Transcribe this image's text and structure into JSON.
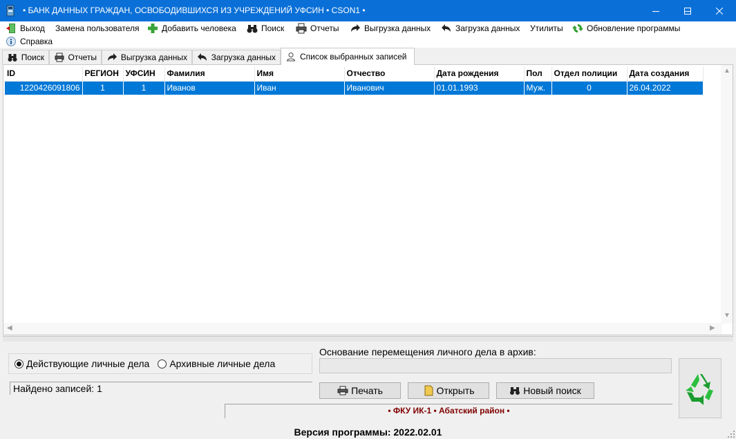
{
  "window": {
    "title": "• БАНК ДАННЫХ ГРАЖДАН, ОСВОБОДИВШИХСЯ ИЗ УЧРЕЖДЕНИЙ УФСИН • CSON1 •"
  },
  "menu": {
    "items": [
      {
        "label": "Выход",
        "icon": "exit-door-icon"
      },
      {
        "label": "Замена пользователя",
        "icon": ""
      },
      {
        "label": "Добавить человека",
        "icon": "plus-icon"
      },
      {
        "label": "Поиск",
        "icon": "binoculars-icon"
      },
      {
        "label": "Отчеты",
        "icon": "printer-icon"
      },
      {
        "label": "Выгрузка данных",
        "icon": "arrow-right-icon"
      },
      {
        "label": "Загрузка данных",
        "icon": "arrow-left-icon"
      },
      {
        "label": "Утилиты",
        "icon": ""
      },
      {
        "label": "Обновление программы",
        "icon": "refresh-icon"
      },
      {
        "label": "Справка",
        "icon": "info-icon"
      }
    ]
  },
  "tabs": [
    {
      "label": "Поиск",
      "icon": "binoculars-icon"
    },
    {
      "label": "Отчеты",
      "icon": "printer-icon"
    },
    {
      "label": "Выгрузка данных",
      "icon": "arrow-right-icon"
    },
    {
      "label": "Загрузка данных",
      "icon": "arrow-left-icon"
    },
    {
      "label": "Список выбранных записей",
      "icon": "user-icon",
      "active": true
    }
  ],
  "table": {
    "columns": [
      "ID",
      "РЕГИОН",
      "УФСИН",
      "Фамилия",
      "Имя",
      "Отчество",
      "Дата рождения",
      "Пол",
      "Отдел полиции",
      "Дата создания"
    ],
    "rows": [
      [
        "1220426091806",
        "1",
        "1",
        "Иванов",
        "Иван",
        "Иванович",
        "01.01.1993",
        "Муж.",
        "0",
        "26.04.2022"
      ]
    ]
  },
  "filters": {
    "active_label": "Действующие личные дела",
    "archive_label": "Архивные личные дела",
    "selected": "active"
  },
  "found_text": "Найдено записей: 1",
  "archive_reason": {
    "label": "Основание перемещения личного дела в архив:",
    "value": ""
  },
  "buttons": {
    "print": "Печать",
    "open": "Открыть",
    "new_search": "Новый поиск"
  },
  "organization": "• ФКУ ИК-1 • Абатский район •",
  "version": "Версия программы: 2022.02.01",
  "colors": {
    "titlebar": "#0a70d8",
    "selection": "#0078d7",
    "org_text": "#800000"
  }
}
